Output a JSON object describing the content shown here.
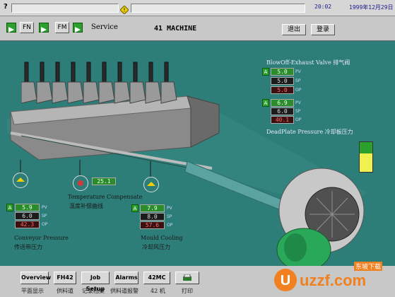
{
  "topbar": {
    "left_mark": "?",
    "warning_icon": "warning-diamond-icon",
    "time": "20:02",
    "date": "1999年12月29日"
  },
  "toolbar": {
    "fn_label": "FN",
    "fm_label": "FM",
    "service_label": "Service",
    "machine_title": "41 MACHINE",
    "exit_label": "退出",
    "login_label": "登录"
  },
  "blowoff": {
    "title": "BlowOff-Exhaust Valve 排气阀",
    "pv": "5.0",
    "sp": "5.0",
    "op": "5.0",
    "tags": {
      "pv": "PV",
      "sp": "SP",
      "op": "OP"
    },
    "mode": "A"
  },
  "deadplate": {
    "title": "DeadPlate Pressure 冷却板压力",
    "pv": "6.9",
    "sp": "6.0",
    "op": "40.1",
    "tags": {
      "pv": "PV",
      "sp": "SP",
      "op": "OP"
    },
    "mode": "A"
  },
  "temperature": {
    "value": "25.1",
    "title": "Temperature Compensate",
    "subtitle": "温度补偿曲线"
  },
  "conveyor": {
    "pv": "5.9",
    "sp": "6.0",
    "op": "42.3",
    "tags": {
      "pv": "PV",
      "sp": "SP",
      "op": "OP"
    },
    "mode": "A",
    "title": "Conveyor Pressure",
    "subtitle": "传送带压力"
  },
  "mould": {
    "pv": "7.9",
    "sp": "8.0",
    "op": "57.6",
    "tags": {
      "pv": "PV",
      "sp": "SP",
      "op": "OP"
    },
    "mode": "A",
    "title": "Mould Cooling",
    "subtitle": "冷却风压力"
  },
  "level_indicator": {
    "upper_color": "#2ca02c",
    "lower_color": "#f0f050"
  },
  "bottom_buttons": [
    {
      "label": "Overview",
      "caption": "平面显示"
    },
    {
      "label": "FH42",
      "caption": "供料道"
    },
    {
      "label": "Job Setup",
      "caption": "记录档案"
    },
    {
      "label": "Alarms",
      "caption": "供料道报警"
    },
    {
      "label": "42MC",
      "caption": "42 机"
    },
    {
      "label": "",
      "caption": "打印"
    }
  ],
  "watermark": {
    "brand": "uzzf.com",
    "tag": "东坡下载"
  }
}
